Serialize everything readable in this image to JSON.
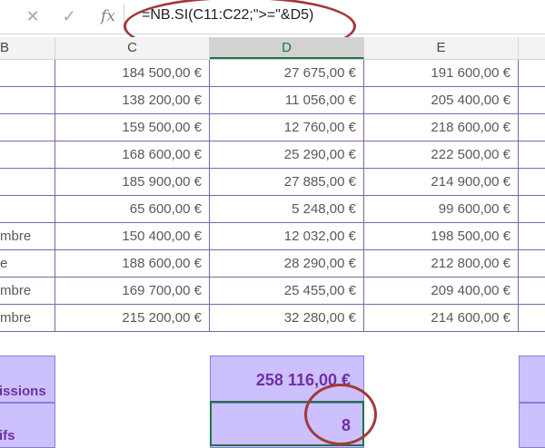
{
  "formula_bar": {
    "cancel_icon": "close-icon",
    "confirm_icon": "checkmark-icon",
    "fx_label": "fx",
    "formula": "=NB.SI(C11:C22;\">=\"&D5)"
  },
  "columns": [
    "B",
    "C",
    "D",
    "E"
  ],
  "rows": [
    {
      "b": "",
      "c": "184 500,00 €",
      "d": "27 675,00 €",
      "e": "191 600,00 €"
    },
    {
      "b": "",
      "c": "138 200,00 €",
      "d": "11 056,00 €",
      "e": "205 400,00 €"
    },
    {
      "b": "",
      "c": "159 500,00 €",
      "d": "12 760,00 €",
      "e": "218 600,00 €"
    },
    {
      "b": "",
      "c": "168 600,00 €",
      "d": "25 290,00 €",
      "e": "222 500,00 €"
    },
    {
      "b": "",
      "c": "185 900,00 €",
      "d": "27 885,00 €",
      "e": "214 900,00 €"
    },
    {
      "b": "",
      "c": "65 600,00 €",
      "d": "5 248,00 €",
      "e": "99 600,00 €"
    },
    {
      "b": "mbre",
      "c": "150 400,00 €",
      "d": "12 032,00 €",
      "e": "198 500,00 €"
    },
    {
      "b": "e",
      "c": "188 600,00 €",
      "d": "28 290,00 €",
      "e": "212 800,00 €"
    },
    {
      "b": "mbre",
      "c": "169 700,00 €",
      "d": "25 455,00 €",
      "e": "209 400,00 €"
    },
    {
      "b": "mbre",
      "c": "215 200,00 €",
      "d": "32 280,00 €",
      "e": "214 600,00 €"
    }
  ],
  "summary": {
    "label_commissions": "issions",
    "total_commissions": "258 116,00 €",
    "label_count": "ifs",
    "count_value": "8"
  },
  "colors": {
    "grid_line": "#8064a2",
    "summary_fill": "#ccc0ff",
    "summary_text": "#7030a0",
    "annotation_ring": "#a23a3a",
    "selection": "#217346"
  }
}
